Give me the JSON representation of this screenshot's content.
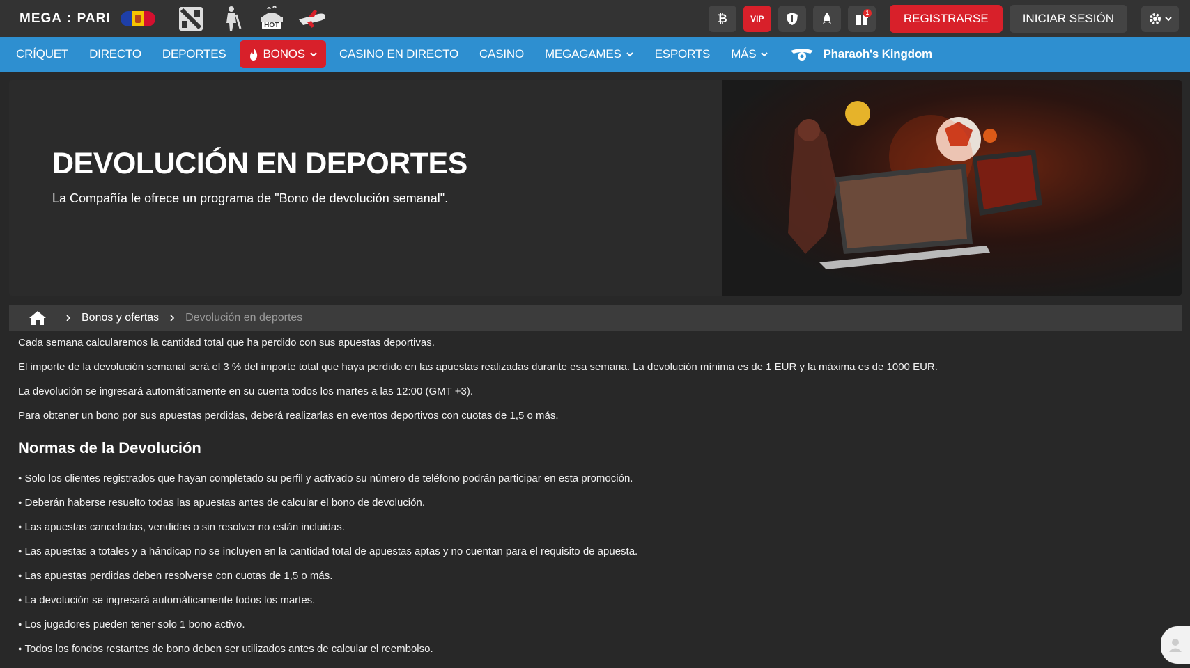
{
  "header": {
    "logo_left": "MEGA",
    "logo_right": "PARI",
    "vip_label": "VIP",
    "gift_badge": "1",
    "register_label": "REGISTRARSE",
    "login_label": "INICIAR SESIÓN",
    "hot_label": "HOT"
  },
  "nav": {
    "items": [
      {
        "label": "CRÍQUET"
      },
      {
        "label": "DIRECTO"
      },
      {
        "label": "DEPORTES"
      },
      {
        "label": "BONOS"
      },
      {
        "label": "CASINO EN DIRECTO"
      },
      {
        "label": "CASINO"
      },
      {
        "label": "MEGAGAMES"
      },
      {
        "label": "ESPORTS"
      },
      {
        "label": "MÁS"
      },
      {
        "label": "Pharaoh's Kingdom"
      }
    ]
  },
  "banner": {
    "title": "DEVOLUCIÓN EN DEPORTES",
    "subtitle": "La Compañía le ofrece un programa de \"Bono de devolución semanal\"."
  },
  "breadcrumb": {
    "items": [
      "Bonos y ofertas",
      "Devolución en deportes"
    ]
  },
  "content": {
    "paragraphs": [
      "Cada semana calcularemos la cantidad total que ha perdido con sus apuestas deportivas.",
      "El importe de la devolución semanal será el 3 % del importe total que haya perdido en las apuestas realizadas durante esa semana. La devolución mínima es de 1 EUR y la máxima es de 1000 EUR.",
      "La devolución se ingresará automáticamente en su cuenta todos los martes a las 12:00 (GMT +3).",
      "Para obtener un bono por sus apuestas perdidas, deberá realizarlas en eventos deportivos con cuotas de 1,5 o más."
    ],
    "rules_heading": "Normas de la Devolución",
    "rules": [
      "Solo los clientes registrados que hayan completado su perfil y activado su número de teléfono podrán participar en esta promoción.",
      "Deberán haberse resuelto todas las apuestas antes de calcular el bono de devolución.",
      "Las apuestas canceladas, vendidas o sin resolver no están incluidas.",
      "Las apuestas a totales y a hándicap no se incluyen en la cantidad total de apuestas aptas y no cuentan para el requisito de apuesta.",
      "Las apuestas perdidas deben resolverse con cuotas de 1,5 o más.",
      "La devolución se ingresará automáticamente todos los martes.",
      "Los jugadores pueden tener solo 1 bono activo.",
      "Todos los fondos restantes de bono deben ser utilizados antes de calcular el reembolso."
    ]
  },
  "colors": {
    "topbar": "#333333",
    "nav": "#2e8fd0",
    "accent_red": "#d8202a",
    "background": "#282828"
  }
}
